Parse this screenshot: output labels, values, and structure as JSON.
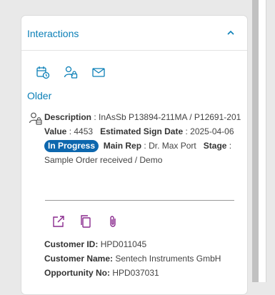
{
  "panel": {
    "title": "Interactions",
    "collapse_icon": "chevron-up-icon",
    "toolbar_icons": [
      "calendar-clock-icon",
      "contact-lock-icon",
      "mail-icon"
    ],
    "section_label": "Older"
  },
  "entry": {
    "icon": "person-lock-icon",
    "description_label": "Description",
    "description_value": "InAsSb P13894-211MA / P12691-201",
    "value_label": "Value",
    "value_value": "4453",
    "est_sign_label": "Estimated Sign Date",
    "est_sign_value": "2025-04-06",
    "status": "In Progress",
    "main_rep_label": "Main Rep",
    "main_rep_value": "Dr. Max Port",
    "stage_label": "Stage",
    "stage_value": "Sample Order received / Demo",
    "actions": [
      "open-external-icon",
      "copy-icon",
      "paperclip-icon"
    ],
    "customer_id_label": "Customer ID:",
    "customer_id": "HPD011045",
    "customer_name_label": "Customer Name:",
    "customer_name": "Sentech Instruments GmbH",
    "opportunity_label": "Opportunity No:",
    "opportunity_no": "HPD037031"
  },
  "colors": {
    "accent": "#0b7fb7",
    "pill": "#0d67ae",
    "action_icons": "#8a2a8e"
  }
}
